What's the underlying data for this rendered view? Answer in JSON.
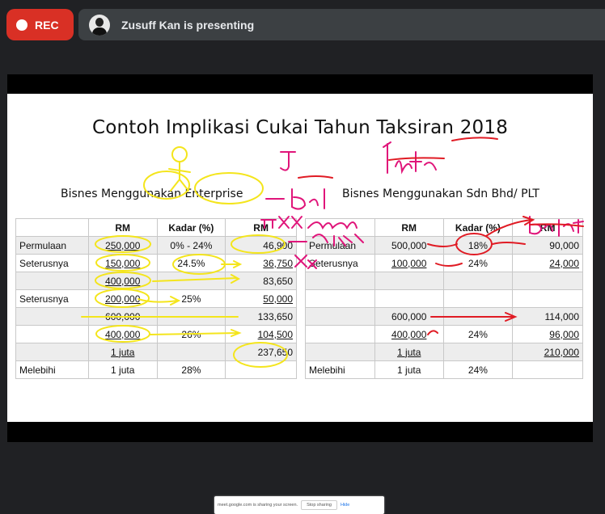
{
  "rec_label": "REC",
  "presenting_text": "Zusuff Kan is presenting",
  "slide": {
    "title": "Contoh Implikasi Cukai Tahun Taksiran 2018",
    "left_heading": "Bisnes Menggunakan Enterprise",
    "right_heading": "Bisnes Menggunakan Sdn Bhd/ PLT",
    "left_table": {
      "headers": [
        "",
        "RM",
        "Kadar (%)",
        "RM"
      ],
      "rows": [
        [
          "Permulaan",
          "250,000",
          "0% - 24%",
          "46,900"
        ],
        [
          "Seterusnya",
          "150,000",
          "24.5%",
          "36,750"
        ],
        [
          "",
          "400,000",
          "",
          "83,650"
        ],
        [
          "Seterusnya",
          "200,000",
          "25%",
          "50,000"
        ],
        [
          "",
          "600,000",
          "",
          "133,650"
        ],
        [
          "",
          "400,000",
          "26%",
          "104,500"
        ],
        [
          "",
          "1 juta",
          "",
          "237,650"
        ],
        [
          "Melebihi",
          "1 juta",
          "28%",
          ""
        ]
      ]
    },
    "right_table": {
      "headers": [
        "",
        "RM",
        "Kadar (%)",
        "RM"
      ],
      "rows": [
        [
          "Permulaan",
          "500,000",
          "18%",
          "90,000"
        ],
        [
          "Seterusnya",
          "100,000",
          "24%",
          "24,000"
        ],
        [
          "",
          "",
          "",
          ""
        ],
        [
          "",
          "",
          "",
          ""
        ],
        [
          "",
          "600,000",
          "",
          "114,000"
        ],
        [
          "",
          "400,000",
          "24%",
          "96,000"
        ],
        [
          "",
          "1 juta",
          "",
          "210,000"
        ],
        [
          "Melebihi",
          "1 juta",
          "24%",
          ""
        ]
      ]
    },
    "annotations": {
      "yellow": "",
      "magenta_notes": [
        "J",
        "1 juta",
        "- Bel",
        "Π xx kasar",
        "- Zakat",
        "xx",
        "Bajet"
      ]
    }
  },
  "share_bar": {
    "message": "meet.google.com is sharing your screen.",
    "stop_label": "Stop sharing",
    "hide_label": "Hide"
  },
  "colors": {
    "rec": "#d93025",
    "highlight_yellow": "#f4e51c",
    "ink_magenta": "#e0157a",
    "ink_red": "#e01b24"
  }
}
